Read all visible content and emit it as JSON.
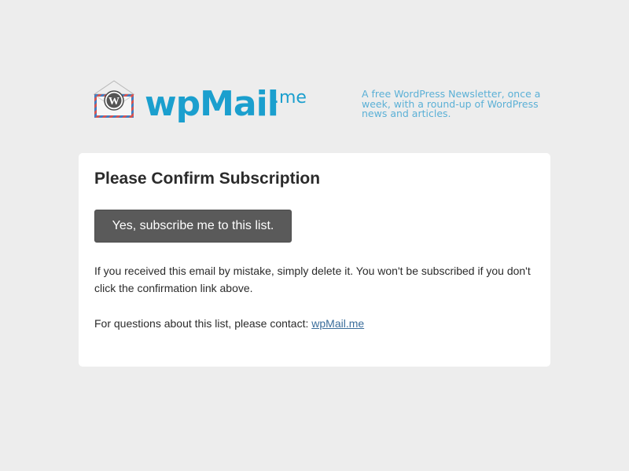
{
  "header": {
    "logo_main": "wpMail",
    "logo_suffix": ".me",
    "tagline": "A free WordPress Newsletter, once a week,  with a round-up of WordPress news and articles."
  },
  "card": {
    "title": "Please Confirm Subscription",
    "confirm_button": "Yes, subscribe me to this list.",
    "mistake_text": "If you received this email by mistake, simply delete it. You won't be subscribed if you don't click the confirmation link above.",
    "contact_prefix": "For questions about this list, please contact: ",
    "contact_link": "wpMail.me"
  },
  "colors": {
    "background": "#ededed",
    "brand": "#1b9fce",
    "tagline": "#5bb0d6",
    "button": "#5a5a5a",
    "link": "#3a6d9b"
  },
  "icons": {
    "logo": "envelope-wordpress-icon"
  }
}
